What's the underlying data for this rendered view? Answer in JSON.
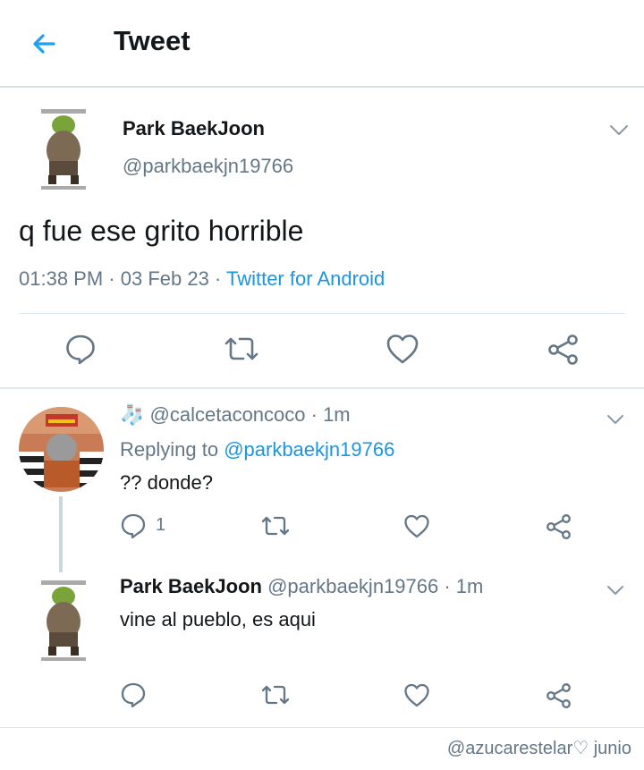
{
  "header": {
    "title": "Tweet"
  },
  "main_tweet": {
    "author_name": "Park BaekJoon",
    "handle": "@parkbaekjn19766",
    "text": "q fue ese grito horrible",
    "time": "01:38 PM",
    "sep1": " · ",
    "date": "03 Feb 23",
    "sep2": " · ",
    "source": "Twitter for Android"
  },
  "reply1": {
    "emoji": "🧦",
    "handle": "@calcetaconcoco",
    "time": " · 1m",
    "replying_label": "Replying to ",
    "replying_handle": "@parkbaekjn19766",
    "text": "?? donde?",
    "reply_count": "1"
  },
  "reply2": {
    "author_name": "Park BaekJoon",
    "handle": "@parkbaekjn19766",
    "time": " · 1m",
    "text": "vine al pueblo, es aqui"
  },
  "watermark": "@azucarestelar♡ junio",
  "colors": {
    "accent": "#1b95e0",
    "muted": "#657786",
    "icon": "#657786",
    "thread_line": "#ccd6dd"
  },
  "icons": [
    "back-arrow-icon",
    "chevron-down-icon",
    "reply-icon",
    "retweet-icon",
    "like-icon",
    "share-icon",
    "sock-icon"
  ]
}
